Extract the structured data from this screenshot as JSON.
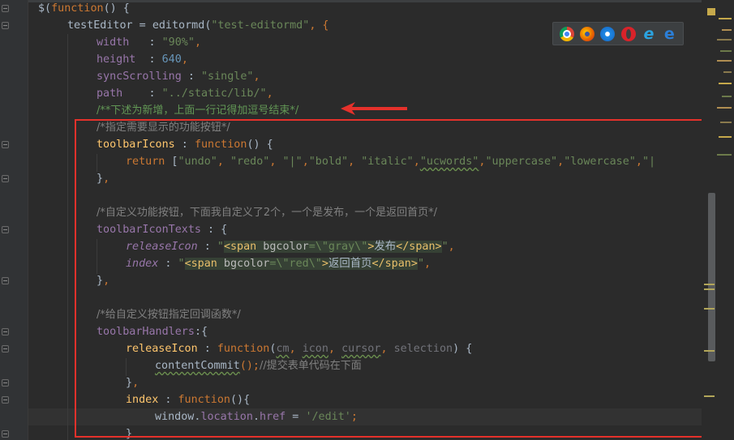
{
  "editor": {
    "lines": {
      "l0": {
        "a": "$(",
        "b": "function",
        "c": "() {"
      },
      "l1": {
        "a": "testEditor",
        "b": " = ",
        "c": "editormd",
        "d": "(",
        "e": "\"test-editormd\"",
        "f": ", {"
      },
      "l2": {
        "a": "width",
        "b": "   : ",
        "c": "\"90%\"",
        "d": ","
      },
      "l3": {
        "a": "height",
        "b": "  : ",
        "c": "640",
        "d": ","
      },
      "l4": {
        "a": "syncScrolling",
        "b": " : ",
        "c": "\"single\"",
        "d": ","
      },
      "l5": {
        "a": "path",
        "b": "    : ",
        "c": "\"../static/lib/\"",
        "d": ","
      },
      "l6": {
        "a": "/**下述为新增，上面一行记得加逗号结束*/"
      },
      "l7": {
        "a": "/*指定需要显示的功能按钮*/"
      },
      "l8": {
        "a": "toolbarIcons",
        "b": " : ",
        "c": "function",
        "d": "() {"
      },
      "l9": {
        "a": "return",
        "b": " [",
        "c": "\"undo\"",
        "d": ", ",
        "e": "\"redo\"",
        "f": ", ",
        "g": "\"|\"",
        "h": ",",
        "i": "\"bold\"",
        "j": ", ",
        "k": "\"italic\"",
        "l": ",",
        "m": "\"ucwords\"",
        "n": ",",
        "o": "\"uppercase\"",
        "p": ",",
        "q": "\"lowercase\"",
        "r": ",",
        "s": "\"|"
      },
      "l10": {
        "a": "}",
        "b": ","
      },
      "l12": {
        "a": "/*自定义功能按钮，下面我自定义了2个，一个是发布，一个是返回首页*/"
      },
      "l13": {
        "a": "toolbarIconTexts",
        "b": " : {"
      },
      "l14": {
        "a": "releaseIcon",
        "b": " : ",
        "c": "\"",
        "d": "<span",
        "e": " bgcolor",
        "f": "=\\\"gray\\\"",
        "g": ">",
        "h": "发布",
        "i": "</span>",
        "j": "\"",
        "k": ","
      },
      "l15": {
        "a": "index",
        "b": " : ",
        "c": "\"",
        "d": "<span",
        "e": " bgcolor",
        "f": "=\\\"red\\\"",
        "g": ">",
        "h": "返回首页",
        "i": "</span>",
        "j": "\"",
        "k": ","
      },
      "l16": {
        "a": "}",
        "b": ","
      },
      "l18": {
        "a": "/*给自定义按钮指定回调函数*/"
      },
      "l19": {
        "a": "toolbarHandlers",
        "b": ":{"
      },
      "l20": {
        "a": "releaseIcon",
        "b": " : ",
        "c": "function",
        "d": "(",
        "e": "cm",
        "f": ", ",
        "g": "icon",
        "h": ", ",
        "i": "cursor",
        "j": ", ",
        "k": "selection",
        "l": ") {"
      },
      "l21": {
        "a": "contentCommit",
        "b": "();",
        "c": "//提交表单代码在下面"
      },
      "l22": {
        "a": "}",
        "b": ","
      },
      "l23": {
        "a": "index",
        "b": " : ",
        "c": "function",
        "d": "(){"
      },
      "l24": {
        "a": "window",
        "b": ".",
        "c": "location",
        "d": ".",
        "e": "href",
        "f": " = ",
        "g": "'/edit'",
        "h": ";"
      },
      "l25": {
        "a": "}"
      }
    }
  },
  "browser_icons": [
    "chrome-icon",
    "firefox-icon",
    "safari-icon",
    "opera-icon",
    "ie-icon",
    "edge-icon"
  ],
  "colors": {
    "background": "#2b2b2b",
    "keyword": "#cc7832",
    "string": "#6a8759",
    "property": "#9876aa",
    "number": "#6897bb",
    "annotation_box": "#e5312b"
  }
}
